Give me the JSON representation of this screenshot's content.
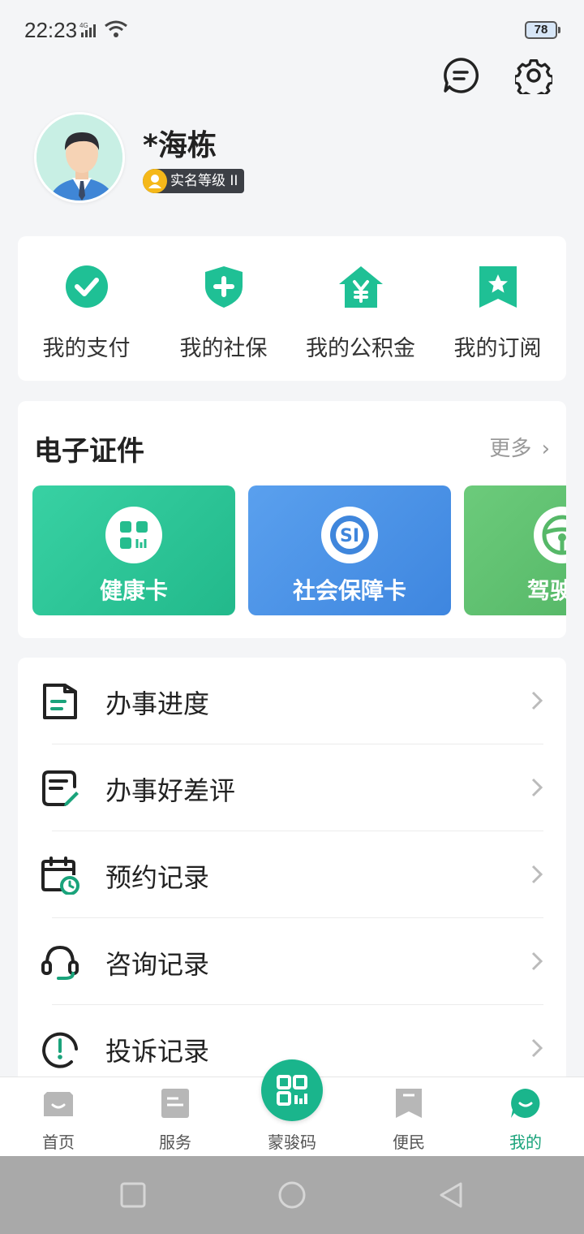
{
  "status_bar": {
    "time": "22:23",
    "network": "4G",
    "battery": "78"
  },
  "header": {
    "message_icon": "message-icon",
    "settings_icon": "gear-icon"
  },
  "profile": {
    "name": "*海栋",
    "verify_level": "实名等级 II"
  },
  "quick_actions": [
    {
      "label": "我的支付",
      "icon": "check-circle-icon"
    },
    {
      "label": "我的社保",
      "icon": "shield-plus-icon"
    },
    {
      "label": "我的公积金",
      "icon": "house-yuan-icon"
    },
    {
      "label": "我的订阅",
      "icon": "bookmark-star-icon"
    }
  ],
  "certificates": {
    "title": "电子证件",
    "more": "更多",
    "items": [
      {
        "label": "健康卡",
        "icon": "qr-code-icon",
        "color": "#2fc79a"
      },
      {
        "label": "社会保障卡",
        "icon": "si-logo-icon",
        "color": "#4a90e2"
      },
      {
        "label": "驾驶",
        "icon": "steering-wheel-icon",
        "color": "#5fbf6e"
      }
    ]
  },
  "menu": [
    {
      "label": "办事进度",
      "icon": "document-icon"
    },
    {
      "label": "办事好差评",
      "icon": "rating-edit-icon"
    },
    {
      "label": "预约记录",
      "icon": "calendar-clock-icon"
    },
    {
      "label": "咨询记录",
      "icon": "headset-icon"
    },
    {
      "label": "投诉记录",
      "icon": "alert-icon"
    }
  ],
  "bottom_nav": [
    {
      "label": "首页",
      "icon": "home-icon"
    },
    {
      "label": "服务",
      "icon": "service-icon"
    },
    {
      "label": "蒙骏码",
      "icon": "qr-code-icon"
    },
    {
      "label": "便民",
      "icon": "bookmark-icon"
    },
    {
      "label": "我的",
      "icon": "profile-icon"
    }
  ],
  "colors": {
    "accent": "#1ab58c",
    "active_tab": "#1aa37b"
  }
}
